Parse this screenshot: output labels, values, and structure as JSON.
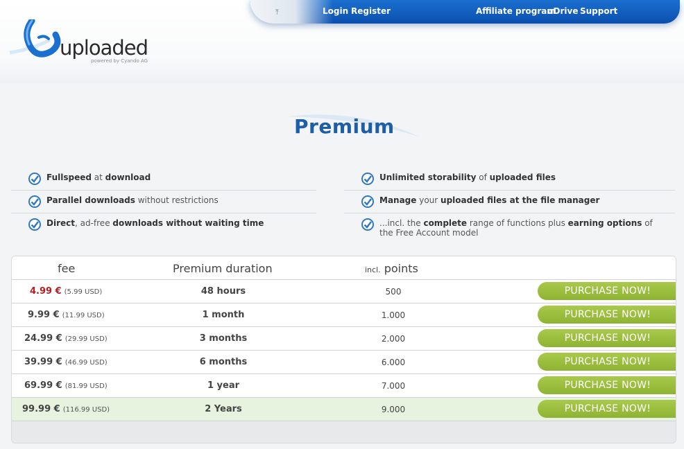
{
  "header": {
    "nav_left": [
      "Login",
      "Register"
    ],
    "nav_right": [
      "Affiliate program",
      "uDrive",
      "Support"
    ],
    "up_arrow_icon": "up-arrow-icon"
  },
  "logo": {
    "name": "uploaded",
    "tagline": "powered by Cyando AG",
    "brand_color": "#1b6fcf"
  },
  "title": "Premium",
  "features_left": [
    {
      "bold1": "Fullspeed",
      "plain1": " at ",
      "bold2": "download",
      "plain2": ""
    },
    {
      "bold1": "Parallel downloads",
      "plain1": " without restrictions",
      "bold2": "",
      "plain2": ""
    },
    {
      "bold1": "Direct",
      "plain1": ", ad-free ",
      "bold2": "downloads without waiting time",
      "plain2": ""
    }
  ],
  "features_right": [
    {
      "bold1": "Unlimited storability",
      "plain1": " of ",
      "bold2": "uploaded files",
      "plain2": ""
    },
    {
      "bold1": "Manage",
      "plain1": " your ",
      "bold2": "uploaded files at the file manager",
      "plain2": ""
    },
    {
      "bold1": "",
      "plain1": "...incl. the ",
      "bold2": "complete",
      "plain2": " range of functions plus ",
      "bold3": "earning options",
      "plain3": " of the Free Account model"
    }
  ],
  "table": {
    "col_fee": "fee",
    "col_duration": "Premium duration",
    "col_points_prefix": "incl.",
    "col_points": "points",
    "buy_label": "PURCHASE NOW!",
    "rows": [
      {
        "eur": "4.99 €",
        "usd": "(5.99 USD)",
        "duration": "48 hours",
        "points": "500",
        "highlight": "red"
      },
      {
        "eur": "9.99 €",
        "usd": "(11.99 USD)",
        "duration": "1 month",
        "points": "1.000"
      },
      {
        "eur": "24.99 €",
        "usd": "(29.99 USD)",
        "duration": "3 months",
        "points": "2.000"
      },
      {
        "eur": "39.99 €",
        "usd": "(46.99 USD)",
        "duration": "6 months",
        "points": "6.000"
      },
      {
        "eur": "69.99 €",
        "usd": "(81.99 USD)",
        "duration": "1 year",
        "points": "7.000"
      },
      {
        "eur": "99.99 €",
        "usd": "(116.99 USD)",
        "duration": "2 Years",
        "points": "9.000",
        "highlight": "green"
      }
    ]
  },
  "colors": {
    "accent_blue": "#1d5ea9",
    "buy_green": "#9cbe3f",
    "price_red": "#b02020",
    "last_row_green": "#e7f2df"
  }
}
